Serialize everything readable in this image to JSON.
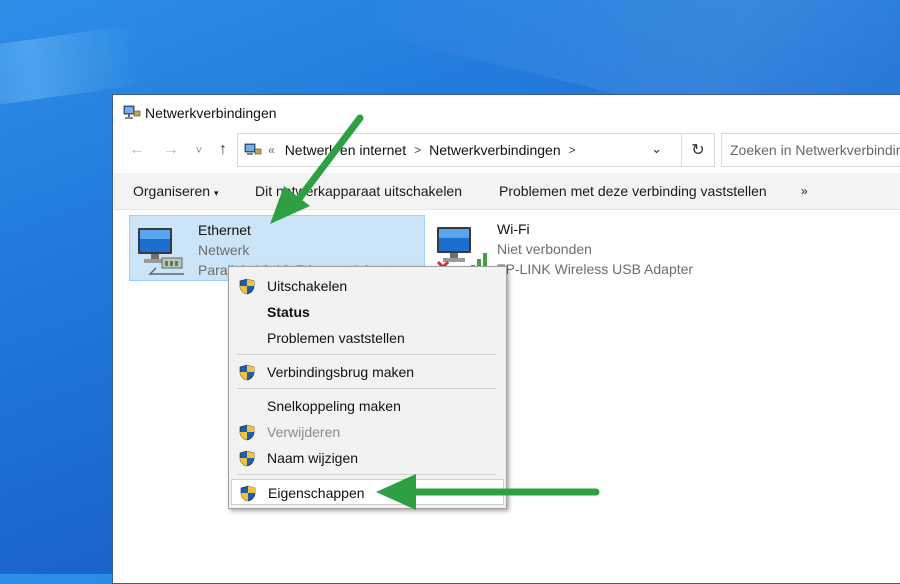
{
  "window": {
    "title": "Netwerkverbindingen",
    "icon": "network-connections-icon"
  },
  "nav": {
    "back": "←",
    "forward": "→",
    "recent": "˅",
    "up": "↑",
    "refresh": "↻",
    "overflow": "«",
    "dropdown": "⌄"
  },
  "address": {
    "crumbs": [
      "Netwerk en internet",
      "Netwerkverbindingen"
    ],
    "separator": ">"
  },
  "search": {
    "placeholder": "Zoeken in Netwerkverbindingen"
  },
  "toolbar": {
    "organize": "Organiseren",
    "disable": "Dit netwerkapparaat uitschakelen",
    "diagnose": "Problemen met deze verbinding vaststellen",
    "more": "»"
  },
  "connections": [
    {
      "name": "Ethernet",
      "status": "Netwerk",
      "adapter": "Parallels VirtIO Ethernet Adapter",
      "selected": true
    },
    {
      "name": "Wi-Fi",
      "status": "Niet verbonden",
      "adapter": "TP-LINK Wireless USB Adapter",
      "selected": false
    }
  ],
  "context_menu": {
    "items": [
      {
        "label": "Uitschakelen",
        "shield": true
      },
      {
        "label": "Status",
        "bold": true
      },
      {
        "label": "Problemen vaststellen"
      },
      {
        "label": "Verbindingsbrug maken",
        "shield": true
      },
      {
        "label": "Snelkoppeling maken"
      },
      {
        "label": "Verwijderen",
        "shield": true,
        "disabled": true
      },
      {
        "label": "Naam wijzigen",
        "shield": true
      },
      {
        "label": "Eigenschappen",
        "shield": true,
        "highlighted": true
      }
    ]
  },
  "colors": {
    "desktop": "#1f74d8",
    "selection": "#cce4f7",
    "arrow": "#2ea043"
  }
}
